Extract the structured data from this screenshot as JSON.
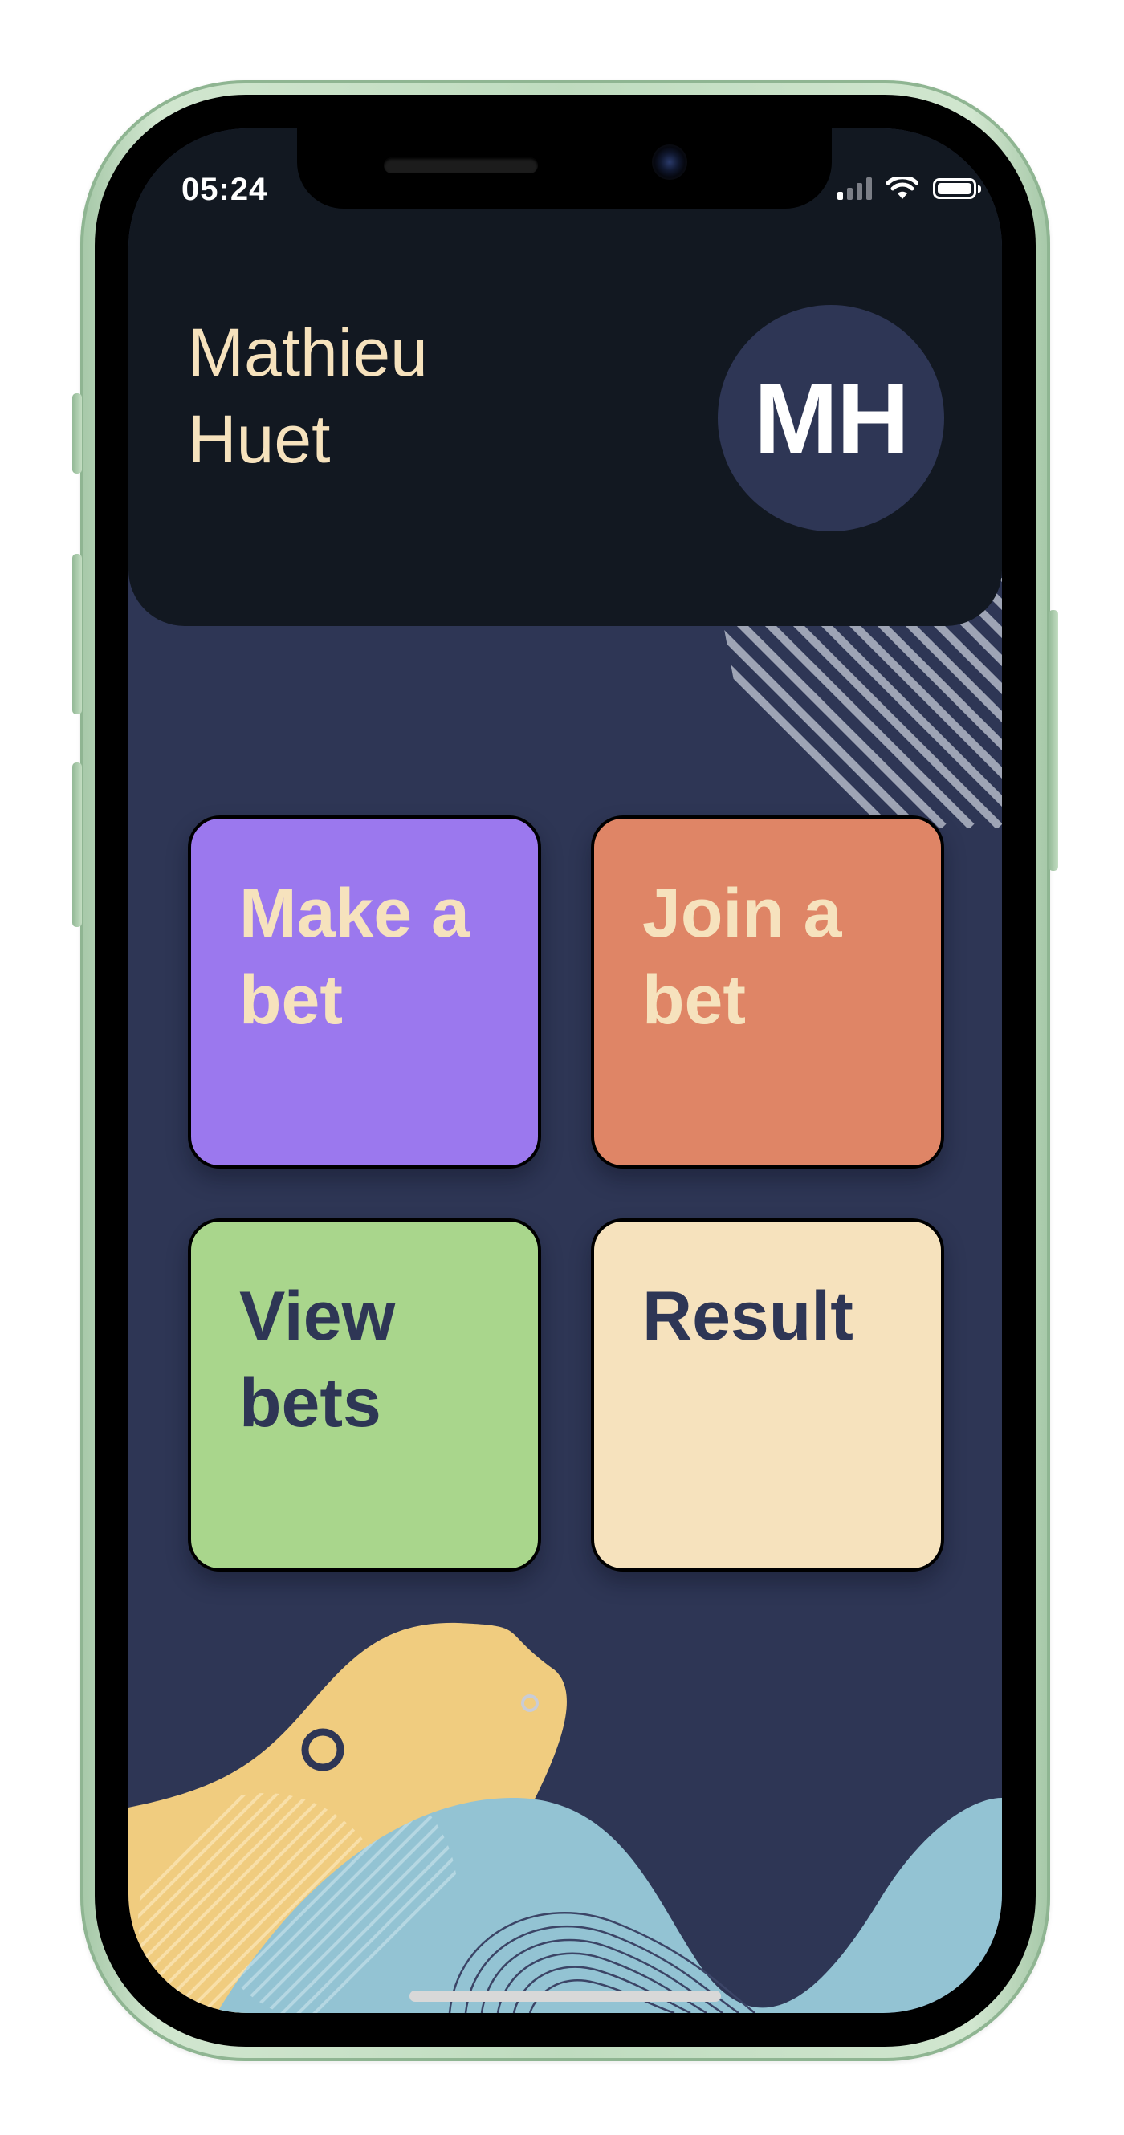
{
  "status_bar": {
    "time": "05:24"
  },
  "profile": {
    "first_name": "Mathieu",
    "last_name": "Huet",
    "initials": "MH"
  },
  "menu": {
    "tiles": [
      {
        "label": "Make a bet",
        "color": "#9b78ee",
        "text_color": "#f6e2bd"
      },
      {
        "label": "Join a bet",
        "color": "#df8566",
        "text_color": "#f6e2bd"
      },
      {
        "label": "View bets",
        "color": "#a9d68c",
        "text_color": "#2e3655"
      },
      {
        "label": "Result",
        "color": "#f6e2bd",
        "text_color": "#2e3655"
      }
    ]
  },
  "colors": {
    "background": "#2e3655",
    "header": "#121821",
    "accent_cream": "#f6e2bd",
    "accent_yellow": "#f0cc7f",
    "accent_blue": "#93c3d3"
  },
  "icons": {
    "signal": "cellular-signal-icon",
    "wifi": "wifi-icon",
    "battery": "battery-icon"
  }
}
